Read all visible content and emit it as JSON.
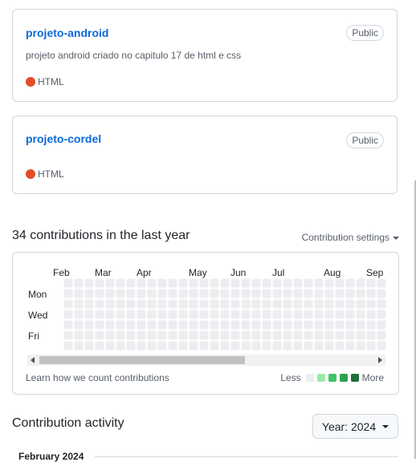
{
  "repos": [
    {
      "name": "projeto-android",
      "badge": "Public",
      "description": "projeto android criado no capitulo 17 de html e css",
      "language": "HTML",
      "language_color": "#e34c26"
    },
    {
      "name": "projeto-cordel",
      "badge": "Public",
      "description": "",
      "language": "HTML",
      "language_color": "#e34c26"
    }
  ],
  "contributions": {
    "title": "34 contributions in the last year",
    "settings_label": "Contribution settings",
    "months": [
      "Feb",
      "Mar",
      "Apr",
      "May",
      "Jun",
      "Jul",
      "Aug",
      "Sep"
    ],
    "days": [
      "Mon",
      "Wed",
      "Fri"
    ],
    "learn_link": "Learn how we count contributions",
    "legend_less": "Less",
    "legend_more": "More",
    "legend_colors": [
      "#ebedf0",
      "#9be9a8",
      "#40c463",
      "#30a14e",
      "#216e39"
    ]
  },
  "activity": {
    "title": "Contribution activity",
    "year_button": "Year: 2024",
    "month_heading": "February 2024"
  }
}
